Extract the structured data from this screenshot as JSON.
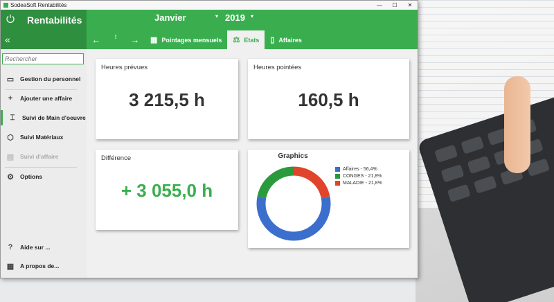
{
  "window": {
    "title": "SodeaSoft Rentabilités",
    "controls": [
      "—",
      "☐",
      "✕"
    ]
  },
  "header": {
    "app_name": "Rentabilités",
    "month": "Janvier",
    "year": "2019",
    "tabs": [
      {
        "label": "Pointages mensuels",
        "icon": "calendar-icon"
      },
      {
        "label": "Etats",
        "icon": "scale-icon",
        "active": true
      },
      {
        "label": "Affaires",
        "icon": "notebook-icon"
      }
    ]
  },
  "sidebar": {
    "search_placeholder": "Rechercher",
    "items": [
      {
        "label": "Gestion du personnel",
        "icon": "id-card-icon"
      },
      {
        "label": "Ajouter une affaire",
        "icon": "plus-icon"
      },
      {
        "label": "Suivi de Main d'oeuvre",
        "icon": "text-cursor-icon",
        "selected": true
      },
      {
        "label": "Suivi Matériaux",
        "icon": "box-icon"
      },
      {
        "label": "Suivi d'affaire",
        "icon": "clipboard-icon",
        "disabled": true
      },
      {
        "label": "Options",
        "icon": "gear-icon"
      },
      {
        "label": "Aide sur ...",
        "icon": "help-icon"
      },
      {
        "label": "A propos de...",
        "icon": "grid-icon"
      }
    ]
  },
  "cards": {
    "heures_prevues": {
      "label": "Heures prévues",
      "value": "3  215,5 h"
    },
    "heures_pointees": {
      "label": "Heures pointées",
      "value": "160,5 h"
    },
    "difference": {
      "label": "Différence",
      "value": "+ 3  055,0 h"
    }
  },
  "chart_data": {
    "type": "pie",
    "title": "Graphics",
    "series": [
      {
        "name": "Affaires - 56,4%",
        "value": 56.4,
        "color": "#3c6fcd"
      },
      {
        "name": "CONGES - 21,8%",
        "value": 21.8,
        "color": "#2a9a3c"
      },
      {
        "name": "MALADIE - 21,8%",
        "value": 21.8,
        "color": "#e0452b"
      }
    ],
    "legend_position": "right"
  }
}
